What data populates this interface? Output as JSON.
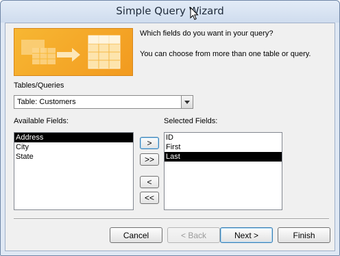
{
  "window": {
    "title": "Simple Query Wizard"
  },
  "prompt": {
    "line1": "Which fields do you want in your query?",
    "line2": "You can choose from more than one table or query."
  },
  "tables": {
    "label": "Tables/Queries",
    "selected": "Table: Customers"
  },
  "available": {
    "label": "Available Fields:",
    "items": [
      "Address",
      "City",
      "State"
    ]
  },
  "selected": {
    "label": "Selected Fields:",
    "items": [
      "ID",
      "First",
      "Last"
    ]
  },
  "transfer": {
    "add_one": ">",
    "add_all": ">>",
    "remove_one": "<",
    "remove_all": "<<"
  },
  "footer": {
    "cancel": "Cancel",
    "back": "< Back",
    "next": "Next >",
    "finish": "Finish"
  },
  "colors": {
    "banner_orange": "#f29a1f",
    "selection": "#000000"
  }
}
